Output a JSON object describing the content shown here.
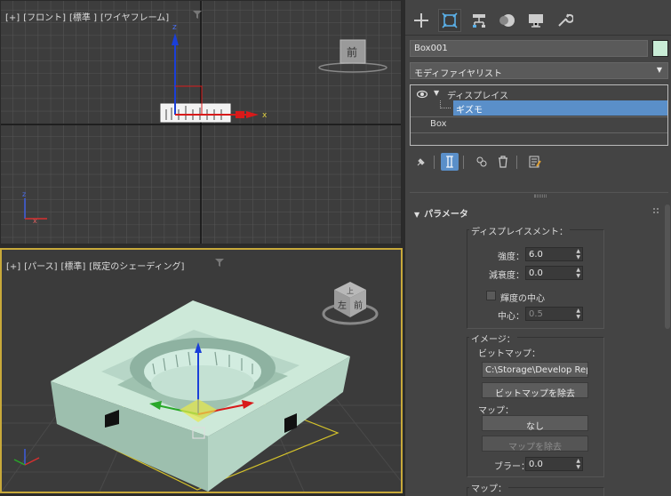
{
  "viewport_front": {
    "label_parts": [
      "[+]",
      "[フロント]",
      "[標準 ]",
      "[ワイヤフレーム]"
    ],
    "viewcube_label": "前",
    "axis_x": "x",
    "axis_z": "z"
  },
  "viewport_persp": {
    "label_parts": [
      "[+]",
      "[パース]",
      "[標準]",
      "[既定のシェーディング]"
    ],
    "viewcube_labels": [
      "上",
      "左",
      "前"
    ]
  },
  "command_panel": {
    "tabs": [
      "create-icon",
      "modify-icon",
      "hierarchy-icon",
      "motion-icon",
      "display-icon",
      "utilities-icon"
    ],
    "object_name": "Box001",
    "object_color": "#c9ecd6",
    "modifier_list": "モディファイヤリスト",
    "stack": {
      "modifier": "ディスプレイス",
      "sub": "ギズモ",
      "base": "Box"
    },
    "rollout_title": "パラメータ",
    "displacement": {
      "label": "ディスプレイスメント：",
      "strength_label": "強度：",
      "strength_value": "6.0",
      "decay_label": "減衰度：",
      "decay_value": "0.0",
      "luminance_center_label": "輝度の中心",
      "center_label": "中心：",
      "center_value": "0.5"
    },
    "image": {
      "label": "イメージ：",
      "bitmap_label": "ビットマップ：",
      "bitmap_path": "C:\\Storage\\Develop Rep",
      "remove_bitmap": "ビットマップを除去",
      "map_label": "マップ：",
      "map_none": "なし",
      "remove_map": "マップを除去",
      "blur_label": "ブラー：",
      "blur_value": "0.0"
    },
    "map_group_label": "マップ："
  }
}
